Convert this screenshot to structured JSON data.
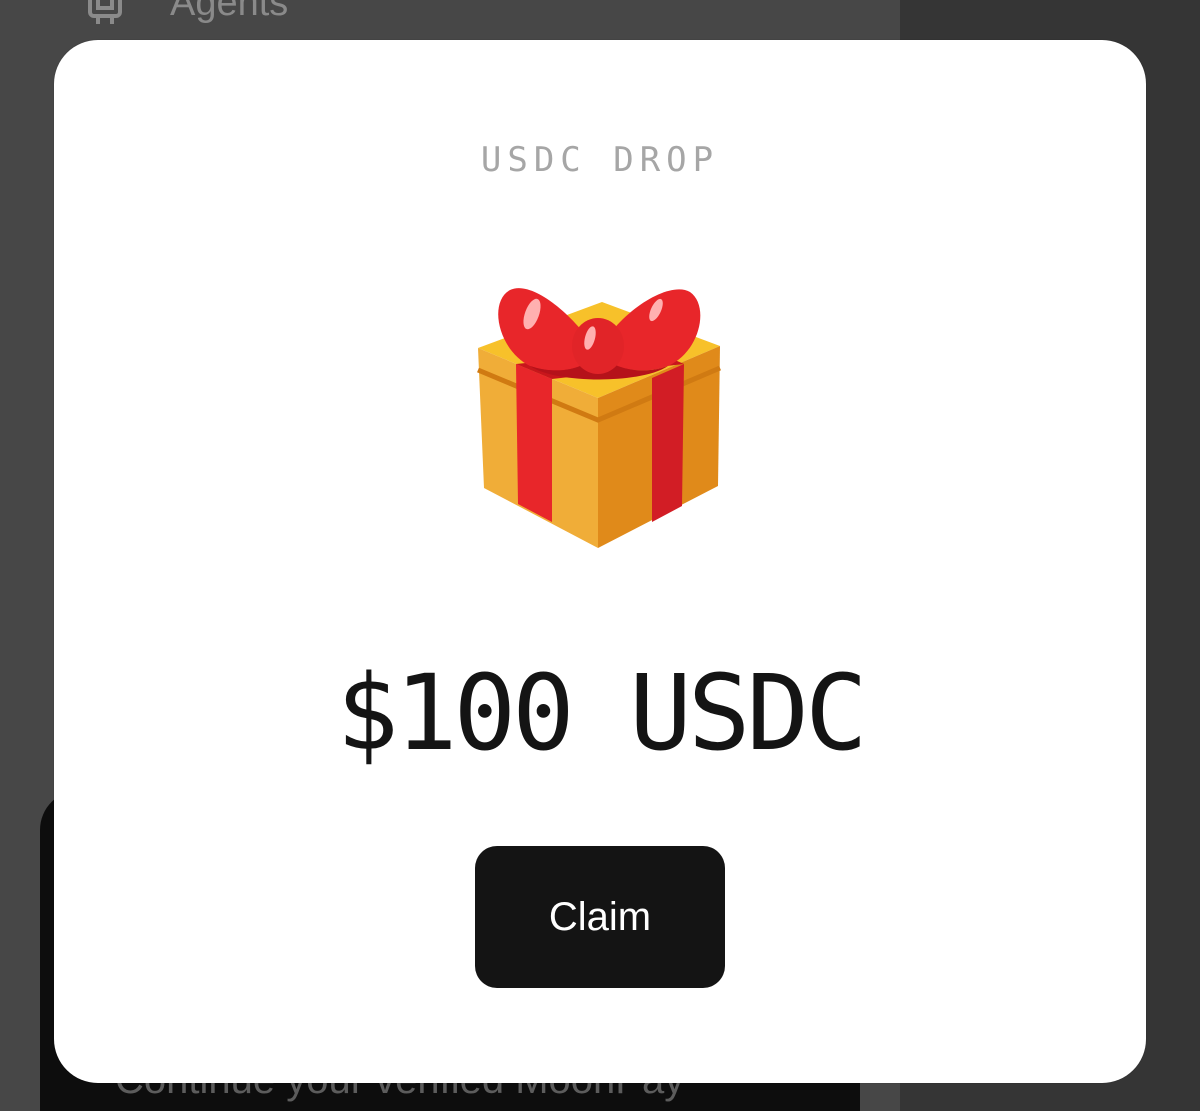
{
  "background": {
    "nav_item_label": "Agents",
    "card_text": "Continue your verified MoonPay"
  },
  "modal": {
    "eyebrow": "USDC DROP",
    "gift_icon": "wrapped-gift-icon",
    "amount": "$100 USDC",
    "claim_label": "Claim"
  },
  "colors": {
    "modal_bg": "#ffffff",
    "button_bg": "#141414",
    "button_text": "#ffffff",
    "eyebrow_text": "#a6a6a6",
    "amount_text": "#141414",
    "overlay": "#3e3e3e"
  }
}
